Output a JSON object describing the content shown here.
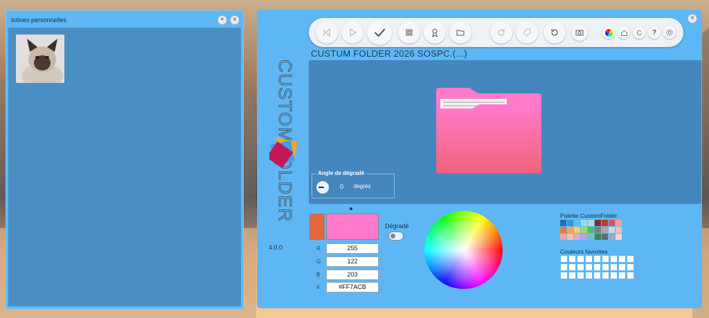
{
  "left_panel": {
    "title": "Icônes personnelles",
    "add_icon": "plus-icon",
    "close_icon": "close-icon"
  },
  "app": {
    "vertical_title": "CUSTOMFOLDER",
    "version": "4.0.0",
    "folder_title": "CUSTUM FOLDER 2026 SOSPC.(...)",
    "folder_color": "#ff7acb"
  },
  "toolbar": {
    "buttons": [
      "skip-back-icon",
      "play-icon",
      "check-icon",
      "grid-icon",
      "award-icon",
      "folder-icon",
      "redo-icon",
      "tag-icon",
      "undo-icon",
      "camera-icon",
      "color-wheel-icon",
      "home-icon",
      "refresh-icon",
      "help-icon",
      "settings-icon"
    ],
    "help_label": "?"
  },
  "gradient": {
    "angle_label": "Angle de dégradé",
    "angle_value": "0",
    "angle_unit": "degrés",
    "toggle_label": "Dégradé"
  },
  "color": {
    "previous": "#e8633f",
    "current": "#ff7acb",
    "r_label": "R",
    "r": "255",
    "g_label": "G",
    "g": "122",
    "b_label": "B",
    "b": "203",
    "hex_label": "#",
    "hex": "#FF7ACB"
  },
  "palette": {
    "title": "Palette CustomFolder",
    "colors": [
      "#1f6fb5",
      "#2b9ad8",
      "#5bc0ea",
      "#8ee0f0",
      "#b8d4e6",
      "#8a2b2b",
      "#c0392b",
      "#e84a5f",
      "#f3a78c",
      "#e07b39",
      "#f2a65a",
      "#f7d06b",
      "#a6d46a",
      "#5cb85c",
      "#7d7d7d",
      "#a9a9a9",
      "#d5d5d5",
      "#f0c0c0",
      "#f4a0a0",
      "#f7c0a0",
      "#e8a7c5",
      "#c0a0e0",
      "#6ac6c0",
      "#2e8b57",
      "#5b6b7b",
      "#9aa9b8",
      "#f6d4d4"
    ]
  },
  "favorites": {
    "title": "Couleurs favorites"
  },
  "window": {
    "close_icon": "close-icon"
  }
}
